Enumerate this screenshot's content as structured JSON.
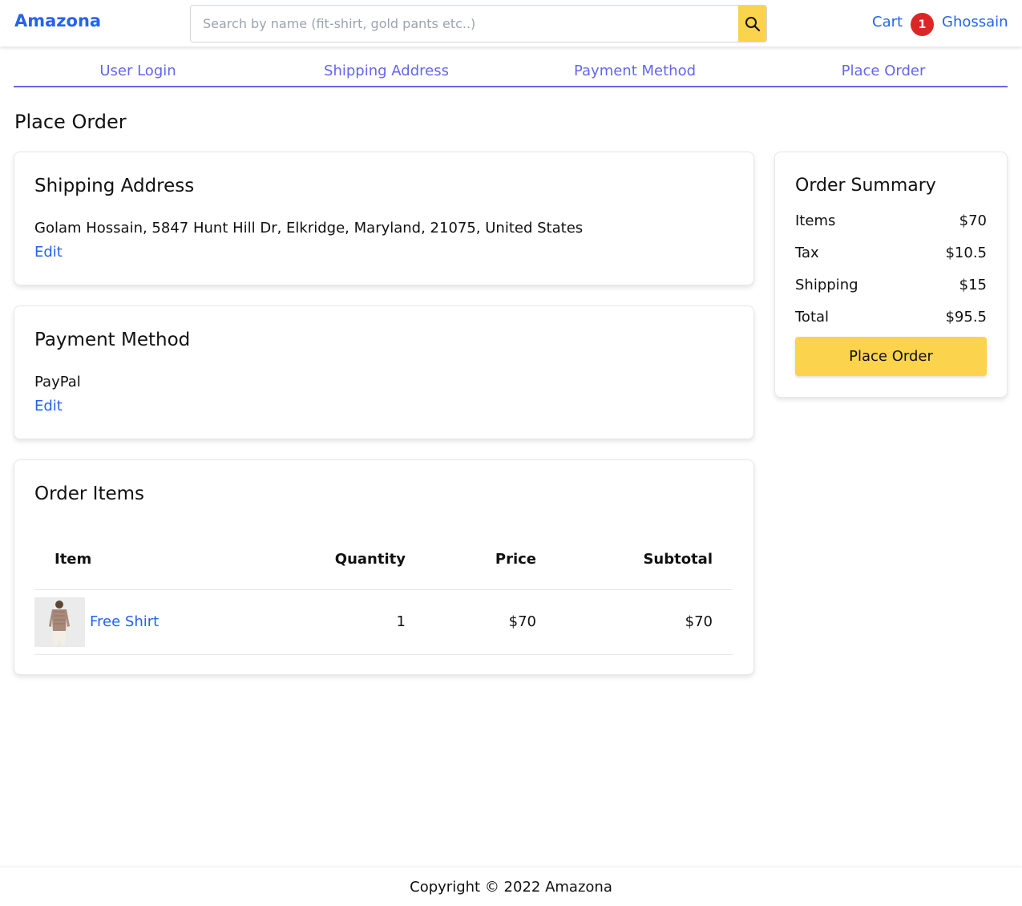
{
  "header": {
    "brand": "Amazona",
    "search_placeholder": "Search by name (fit-shirt, gold pants etc..)",
    "search_value": "",
    "search_icon": "search-icon",
    "cart_label": "Cart",
    "cart_count": "1",
    "user_name": "Ghossain"
  },
  "wizard": {
    "steps": [
      "User Login",
      "Shipping Address",
      "Payment Method",
      "Place Order"
    ]
  },
  "page_title": "Place Order",
  "shipping": {
    "title": "Shipping Address",
    "address": "Golam Hossain, 5847 Hunt Hill Dr, Elkridge, Maryland, 21075, United States",
    "edit_label": "Edit"
  },
  "payment": {
    "title": "Payment Method",
    "method": "PayPal",
    "edit_label": "Edit"
  },
  "order_items": {
    "title": "Order Items",
    "columns": [
      "Item",
      "Quantity",
      "Price",
      "Subtotal"
    ],
    "rows": [
      {
        "name": "Free Shirt",
        "quantity": "1",
        "price": "$70",
        "subtotal": "$70"
      }
    ]
  },
  "summary": {
    "title": "Order Summary",
    "rows": [
      {
        "label": "Items",
        "value": "$70"
      },
      {
        "label": "Tax",
        "value": "$10.5"
      },
      {
        "label": "Shipping",
        "value": "$15"
      },
      {
        "label": "Total",
        "value": "$95.5"
      }
    ],
    "button_label": "Place Order"
  },
  "footer": {
    "copyright": "Copyright © 2022 Amazona"
  },
  "colors": {
    "link": "#2563eb",
    "accent_yellow": "#fcd34d",
    "wizard": "#6366f1",
    "badge": "#dc2626"
  }
}
